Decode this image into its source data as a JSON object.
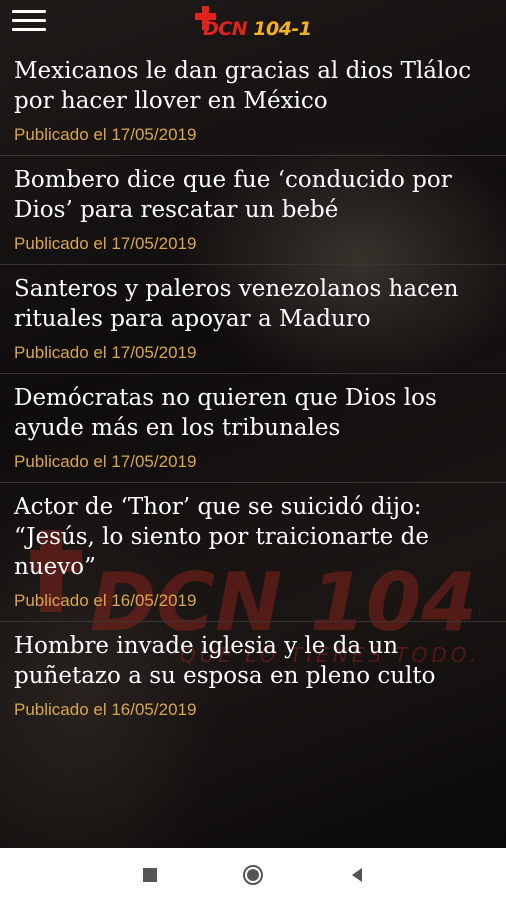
{
  "app": {
    "logo_text": "DCN",
    "logo_number": "104-1",
    "watermark_text": "DCN 104-1",
    "watermark_tagline": "QUE LO TIENES TODO..."
  },
  "colors": {
    "accent_red": "#e0241b",
    "accent_gold": "#d9a648",
    "logo_yellow": "#f6b21c"
  },
  "articles": [
    {
      "title": "Mexicanos le dan gracias al dios Tláloc por hacer llover en México",
      "date": "Publicado el 17/05/2019"
    },
    {
      "title": "Bombero dice que fue ‘conducido por Dios’ para rescatar un bebé",
      "date": "Publicado el 17/05/2019"
    },
    {
      "title": "Santeros y paleros venezolanos hacen rituales para apoyar a Maduro",
      "date": "Publicado el 17/05/2019"
    },
    {
      "title": "Demócratas no quieren que Dios los ayude más en los tribunales",
      "date": "Publicado el 17/05/2019"
    },
    {
      "title": "Actor de ‘Thor’ que se suicidó dijo: “Jesús, lo siento por traicionarte de nuevo”",
      "date": "Publicado el 16/05/2019"
    },
    {
      "title": "Hombre invade iglesia y le da un puñetazo a su esposa en pleno culto",
      "date": "Publicado el 16/05/2019"
    }
  ],
  "navbar": {
    "icons": [
      "recent-apps-icon",
      "home-icon",
      "back-icon"
    ]
  }
}
